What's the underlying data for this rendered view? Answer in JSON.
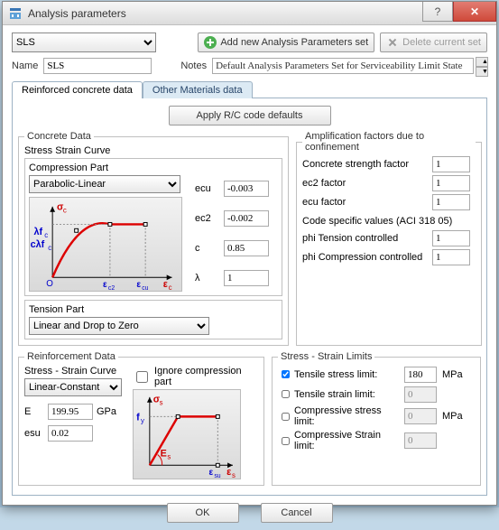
{
  "window": {
    "title": "Analysis parameters",
    "help_hint": "?",
    "close_hint": "×"
  },
  "topbar": {
    "set_selected": "SLS",
    "add_label": "Add new Analysis Parameters set",
    "delete_label": "Delete current set"
  },
  "fields": {
    "name_label": "Name",
    "name_value": "SLS",
    "notes_label": "Notes",
    "notes_value": "Default Analysis Parameters Set for Serviceability Limit State"
  },
  "tabs": {
    "reinforced": "Reinforced concrete data",
    "other": "Other Materials data"
  },
  "apply_label": "Apply R/C code defaults",
  "concrete": {
    "legend": "Concrete Data",
    "stress_curve_label": "Stress Strain Curve",
    "compression_label": "Compression Part",
    "compression_selected": "Parabolic-Linear",
    "tension_label": "Tension Part",
    "tension_selected": "Linear and Drop to Zero",
    "params": {
      "ecu_label": "ecu",
      "ecu_value": "-0.003",
      "ec2_label": "ec2",
      "ec2_value": "-0.002",
      "c_label": "c",
      "c_value": "0.85",
      "lambda_label": "λ",
      "lambda_value": "1"
    },
    "graph": {
      "sigma_c": "σc",
      "lambda_fc": "λfc",
      "clambda_fc": "cλfc",
      "eps_c2": "εc2",
      "eps_cu": "εcu",
      "eps_c": "εc",
      "O": "O"
    }
  },
  "amplification": {
    "legend": "Amplification factors due to confinement",
    "rows": {
      "csf_label": "Concrete strength factor",
      "csf_value": "1",
      "ec2f_label": "ec2 factor",
      "ec2f_value": "1",
      "ecuf_label": "ecu factor",
      "ecuf_value": "1"
    },
    "code_label": "Code specific values (ACI 318 05)",
    "phi_t_label": "phi Tension controlled",
    "phi_t_value": "1",
    "phi_c_label": "phi Compression controlled",
    "phi_c_value": "1"
  },
  "reinforcement": {
    "legend": "Reinforcement Data",
    "curve_label": "Stress - Strain Curve",
    "curve_selected": "Linear-Constant",
    "E_label": "E",
    "E_value": "199.95",
    "E_unit": "GPa",
    "esu_label": "esu",
    "esu_value": "0.02",
    "ignore_label": "Ignore compression part",
    "graph": {
      "sigma_s": "σs",
      "fy": "fy",
      "Es": "Es",
      "eps_su": "εsu",
      "eps_s": "εs"
    }
  },
  "limits": {
    "legend": "Stress - Strain Limits",
    "tensile_stress_label": "Tensile stress limit:",
    "tensile_stress_value": "180",
    "mpa": "MPa",
    "tensile_strain_label": "Tensile strain limit:",
    "tensile_strain_value": "0",
    "comp_stress_label": "Compressive stress limit:",
    "comp_stress_value": "0",
    "comp_strain_label": "Compressive Strain limit:",
    "comp_strain_value": "0"
  },
  "footer": {
    "ok": "OK",
    "cancel": "Cancel"
  }
}
